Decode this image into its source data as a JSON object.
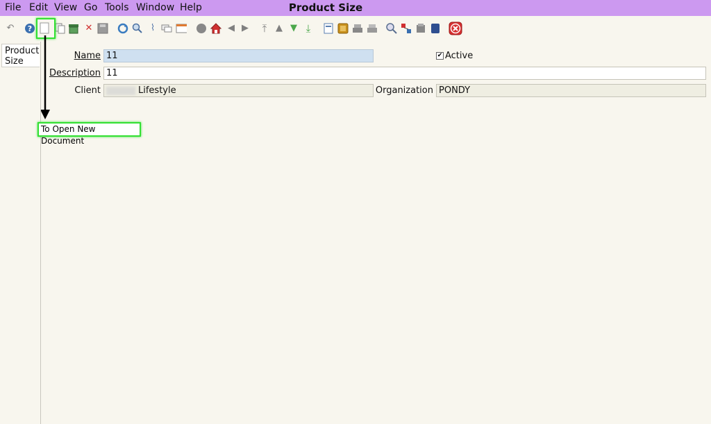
{
  "menubar": {
    "items": [
      "File",
      "Edit",
      "View",
      "Go",
      "Tools",
      "Window",
      "Help"
    ],
    "title": "Product Size"
  },
  "sidebar": {
    "tab_label": "Product Size"
  },
  "form": {
    "name_label": "Name",
    "name_value": "11",
    "description_label": "Description",
    "description_value": "11",
    "client_label": "Client",
    "client_value": "Lifestyle",
    "organization_label": "Organization",
    "organization_value": "PONDY",
    "active_label": "Active",
    "active_checked": true
  },
  "annotation": {
    "tooltip_text": "To Open New Document"
  },
  "colors": {
    "menubar_bg": "#cc99f0",
    "highlight": "#33e033",
    "name_field_bg": "#cfe0f0"
  }
}
